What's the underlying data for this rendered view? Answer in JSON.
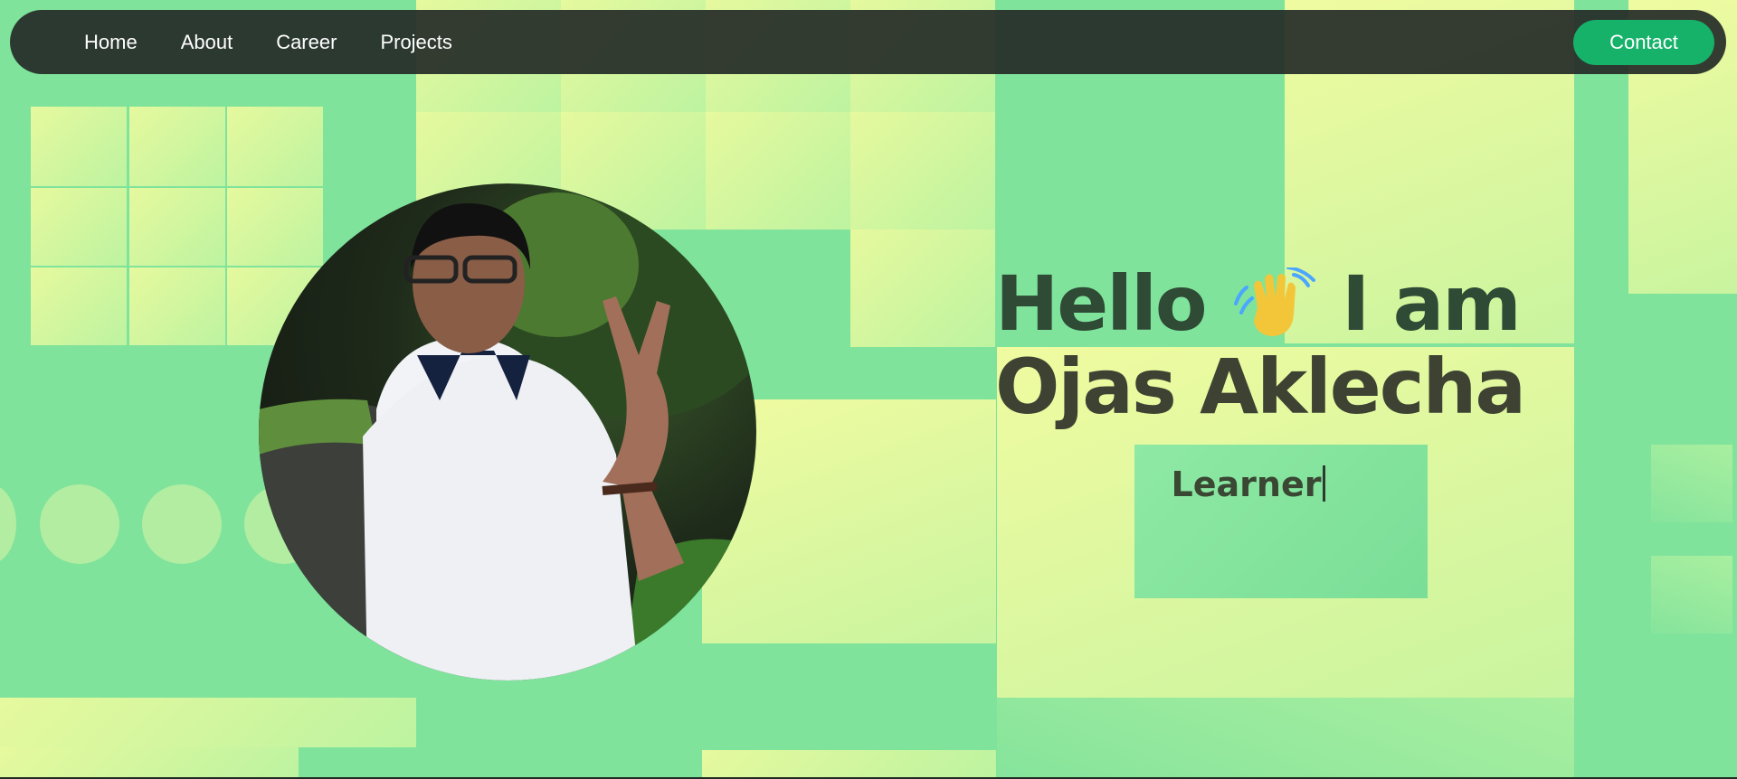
{
  "nav": {
    "links": [
      "Home",
      "About",
      "Career",
      "Projects"
    ],
    "contact_label": "Contact"
  },
  "hero": {
    "greeting": "Hello",
    "greeting_suffix": "I am",
    "name": "Ojas Aklecha",
    "role": "Learner"
  },
  "colors": {
    "nav_bg": "#262c28",
    "contact_bg": "#17b26a",
    "background": "#7fe39b",
    "heading": "#2f4a35"
  },
  "icons": {
    "wave": "waving-hand-icon",
    "photo": "profile-photo"
  }
}
